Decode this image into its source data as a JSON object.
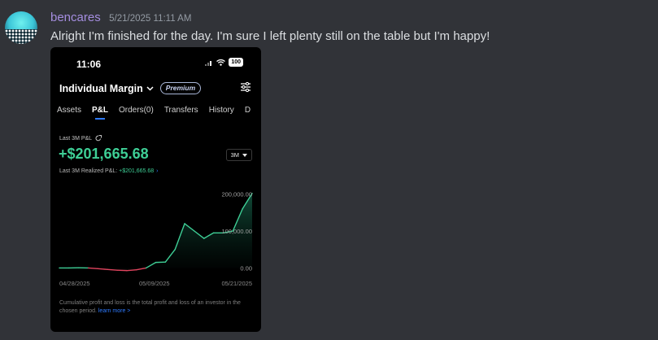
{
  "message": {
    "username": "bencares",
    "timestamp": "5/21/2025 11:11 AM",
    "text": "Alright I'm finished for the day. I'm sure I left plenty still on the table but I'm happy!"
  },
  "phone": {
    "status_time": "11:06",
    "battery": "100",
    "account_label": "Individual Margin",
    "premium_badge": "Premium",
    "tabs": [
      {
        "label": "Assets",
        "active": false
      },
      {
        "label": "P&L",
        "active": true
      },
      {
        "label": "Orders(0)",
        "active": false
      },
      {
        "label": "Transfers",
        "active": false
      },
      {
        "label": "History",
        "active": false
      },
      {
        "label": "D",
        "active": false
      }
    ],
    "pl_label": "Last 3M P&L",
    "pl_value": "+$201,665.68",
    "period": "3M",
    "realized_label": "Last 3M Realized P&L: ",
    "realized_value": "+$201,665.68",
    "footnote": "Cumulative profit and loss is the total profit and loss of an investor in the chosen period. ",
    "footnote_link": "learn more >"
  },
  "colors": {
    "positive": "#3ecf96",
    "negative": "#e0445e",
    "accent": "#2f7bff",
    "username": "#a58ee0"
  },
  "chart_data": {
    "type": "area",
    "x_labels": [
      "04/28/2025",
      "05/09/2025",
      "05/21/2025"
    ],
    "y_tick_labels": [
      "200,000.00",
      "100,000.00",
      "0.00"
    ],
    "ylim": [
      -10000,
      210000
    ],
    "series": [
      {
        "values": [
          0,
          0,
          500,
          0,
          -2000,
          -4000,
          -6000,
          -7000,
          -5000,
          0,
          15000,
          16000,
          50000,
          120000,
          100000,
          80000,
          95000,
          95000,
          100000,
          160000,
          201665
        ]
      }
    ]
  }
}
